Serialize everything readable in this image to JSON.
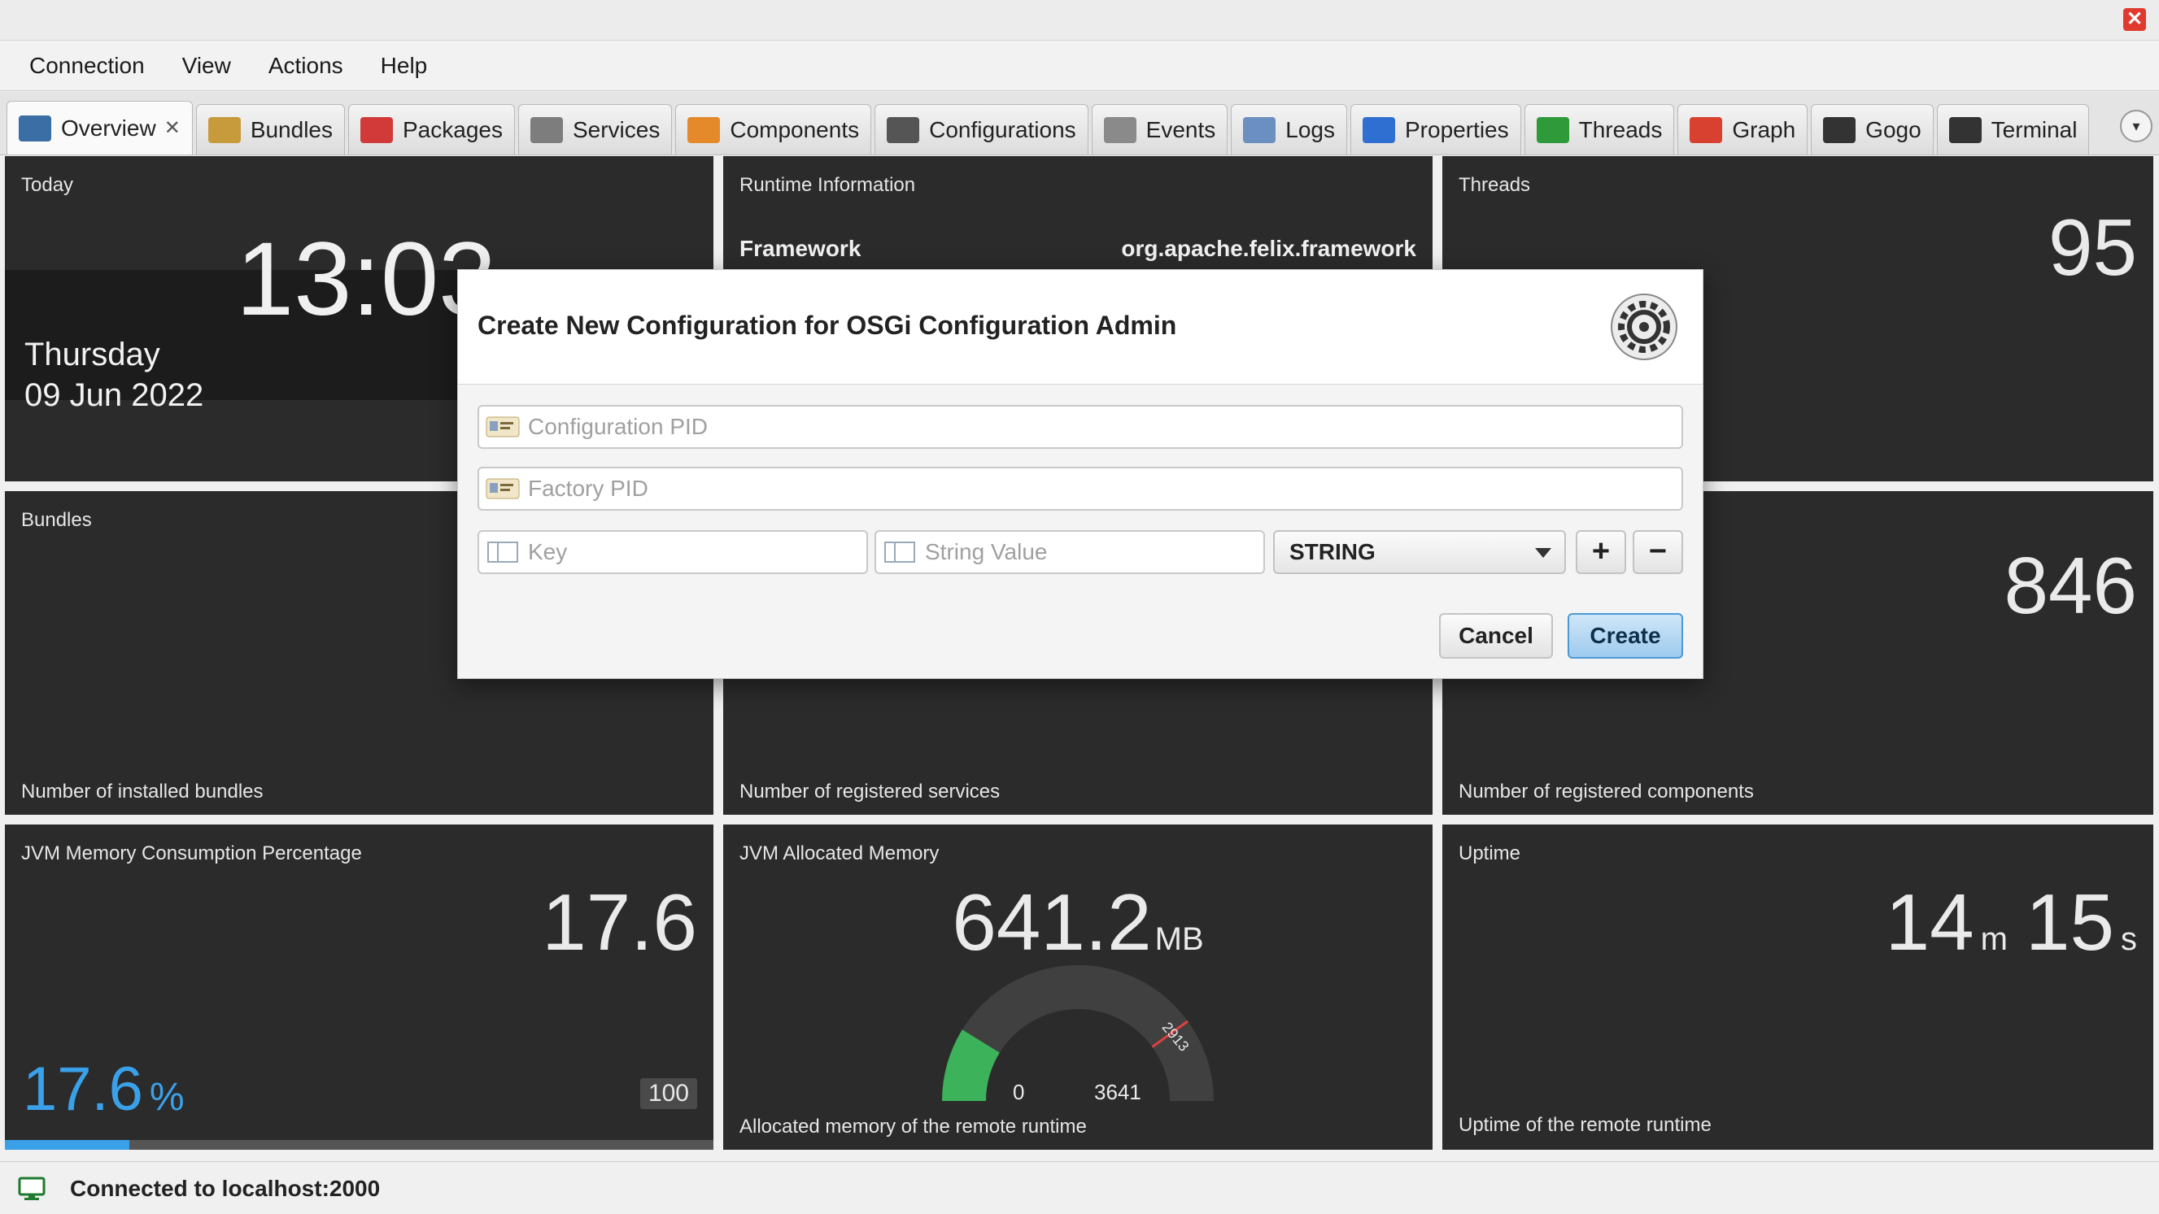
{
  "window": {
    "close_label": "✕"
  },
  "menu": [
    "Connection",
    "View",
    "Actions",
    "Help"
  ],
  "tabs": [
    {
      "label": "Overview",
      "icon": "gauge-icon",
      "color": "#3a6ea5",
      "active": true
    },
    {
      "label": "Bundles",
      "icon": "box-icon",
      "color": "#c79a3c"
    },
    {
      "label": "Packages",
      "icon": "package-icon",
      "color": "#d23a3a"
    },
    {
      "label": "Services",
      "icon": "server-icon",
      "color": "#7d7d7d"
    },
    {
      "label": "Components",
      "icon": "components-icon",
      "color": "#e58a2b"
    },
    {
      "label": "Configurations",
      "icon": "gear-icon",
      "color": "#555555"
    },
    {
      "label": "Events",
      "icon": "events-icon",
      "color": "#8a8a8a"
    },
    {
      "label": "Logs",
      "icon": "logs-icon",
      "color": "#6a8fc0"
    },
    {
      "label": "Properties",
      "icon": "properties-icon",
      "color": "#2f6fd1"
    },
    {
      "label": "Threads",
      "icon": "threads-icon",
      "color": "#2f9a3a"
    },
    {
      "label": "Graph",
      "icon": "graph-icon",
      "color": "#d8402f"
    },
    {
      "label": "Gogo",
      "icon": "console-icon",
      "color": "#333333"
    },
    {
      "label": "Terminal",
      "icon": "terminal-icon",
      "color": "#333333"
    }
  ],
  "tab_close_label": "✕",
  "tab_menu_label": "▾",
  "tiles": {
    "today": {
      "title": "Today",
      "time": "13:03",
      "day": "Thursday",
      "date": "09 Jun 2022"
    },
    "runtime": {
      "title": "Runtime Information",
      "key": "Framework",
      "value": "org.apache.felix.framework"
    },
    "threads": {
      "title": "Threads",
      "value": "95"
    },
    "bundles": {
      "title": "Bundles",
      "description": "Number of installed bundles"
    },
    "services": {
      "description": "Number of registered services"
    },
    "components": {
      "value": "846",
      "description": "Number of registered components"
    },
    "jvm_pct": {
      "title": "JVM Memory Consumption Percentage",
      "value": "17.6",
      "small_value": "17.6",
      "unit": "%",
      "max": "100",
      "fill_fraction": 0.176
    },
    "jvm_alloc": {
      "title": "JVM Allocated Memory",
      "value": "641.2",
      "unit": "MB",
      "gauge_min": "0",
      "gauge_max": "3641",
      "gauge_marker": "2913",
      "description": "Allocated memory of the remote runtime",
      "gauge_fraction": 0.176
    },
    "uptime": {
      "title": "Uptime",
      "minutes": "14",
      "minutes_unit": "m",
      "seconds": "15",
      "seconds_unit": "s",
      "description": "Uptime of the remote runtime"
    }
  },
  "dialog": {
    "title": "Create New Configuration for OSGi Configuration Admin",
    "pid_placeholder": "Configuration PID",
    "factory_pid_placeholder": "Factory PID",
    "key_placeholder": "Key",
    "value_placeholder": "String Value",
    "type_selected": "STRING",
    "add_label": "+",
    "remove_label": "−",
    "cancel_label": "Cancel",
    "create_label": "Create"
  },
  "status": {
    "text": "Connected to localhost:2000"
  },
  "colors": {
    "accent_blue": "#3aa0e8",
    "gauge_green": "#3cb35a",
    "tile_bg": "#2b2b2b"
  }
}
